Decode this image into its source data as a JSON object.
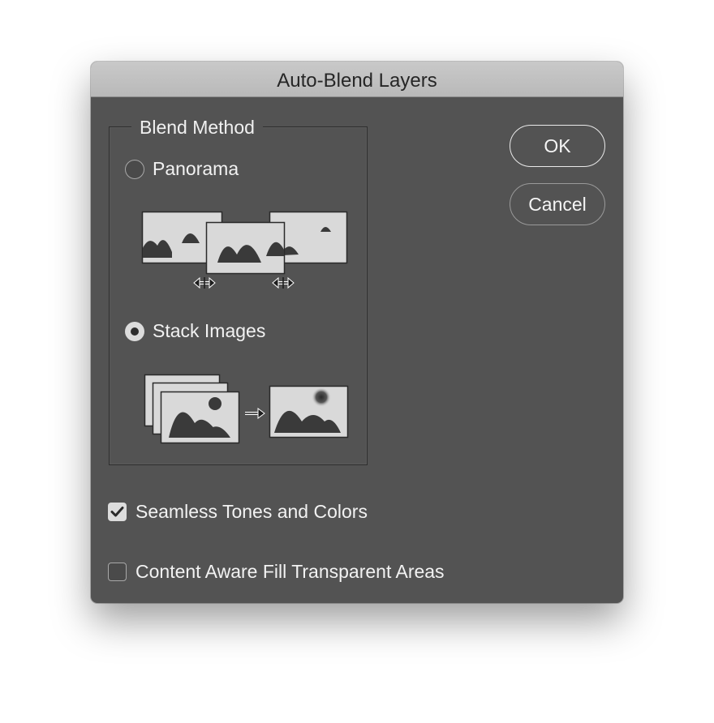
{
  "dialog": {
    "title": "Auto-Blend Layers"
  },
  "blend_method": {
    "legend": "Blend Method",
    "options": [
      {
        "label": "Panorama",
        "selected": false,
        "icon": "panorama-illustration"
      },
      {
        "label": "Stack Images",
        "selected": true,
        "icon": "stack-images-illustration"
      }
    ]
  },
  "options": {
    "seamless": {
      "label": "Seamless Tones and Colors",
      "checked": true
    },
    "content_aware": {
      "label": "Content Aware Fill Transparent Areas",
      "checked": false
    }
  },
  "buttons": {
    "ok": "OK",
    "cancel": "Cancel"
  },
  "colors": {
    "dialog_bg": "#535353",
    "titlebar_bg": "#c4c4c4",
    "text": "#f2f2f2",
    "illustration_fill": "#d9d9d9",
    "illustration_dark": "#3a3a3a"
  }
}
